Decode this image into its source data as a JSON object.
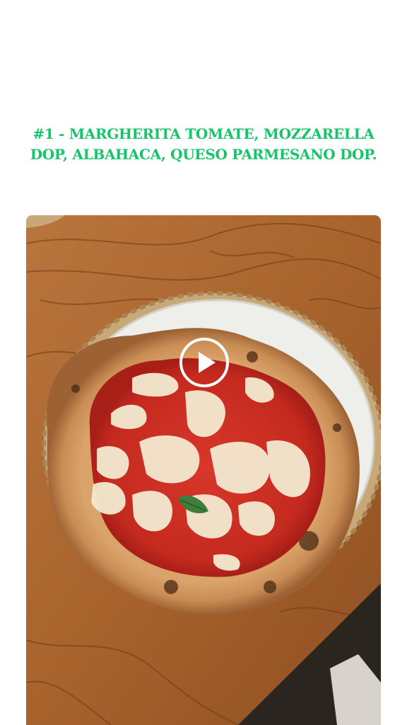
{
  "item": {
    "heading_line1": "#1 - MARGHERITA TOMATE, MOZZARELLA",
    "heading_line2": "DOP, ALBAHACA, QUESO PARMESANO DOP."
  },
  "media": {
    "type": "video",
    "play_icon": "play-circle-icon"
  },
  "colors": {
    "heading": "#16c46a",
    "background": "#ffffff",
    "play_icon": "#ffffff"
  }
}
